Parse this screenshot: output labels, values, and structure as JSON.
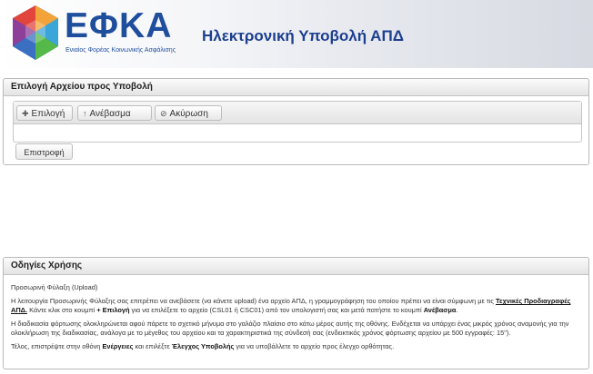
{
  "header": {
    "logo_text": "ΕΦΚΑ",
    "logo_subtitle": "Ενιαίος Φορέας Κοινωνικής Ασφάλισης",
    "app_title": "Ηλεκτρονική Υποβολή ΑΠΔ",
    "logo_colors": [
      "#f2a43a",
      "#e2453c",
      "#8e3f9a",
      "#3a6fc1",
      "#3aa5d8",
      "#54b948"
    ]
  },
  "upload_panel": {
    "title": "Επιλογή Αρχείου προς Υποβολή",
    "choose_label": "Επιλογή",
    "choose_icon": "plus-icon",
    "upload_label": "Ανέβασμα",
    "upload_icon": "upload-arrow-icon",
    "cancel_label": "Ακύρωση",
    "cancel_icon": "cancel-circle-icon",
    "back_label": "Επιστροφή"
  },
  "help_panel": {
    "title": "Οδηγίες Χρήσης",
    "p1": "Προσωρινή Φύλαξη (Upload)",
    "p2": {
      "t1": "Η λειτουργία Προσωρινής Φύλαξης σας επιτρέπει να ανεβάσετε (να κάνετε upload) ένα αρχείο ΑΠΔ, η γραμμογράφηση του οποίου πρέπει να είναι σύμφωνη με τις ",
      "link": "Τεχνικές Προδιαγραφές ΑΠΔ.",
      "t2": " Κάντε κλικ στο κουμπί ",
      "b1": "+ Επιλογή",
      "t3": " για να επιλέξετε το αρχείο (CSL01 ή CSC01) από τον υπολογιστή σας και μετά πατήστε το κουμπί ",
      "b2": "Ανέβασμα",
      "t4": "."
    },
    "p3": "Η διαδικασία φόρτωσης ολοκληρώνεται αφού πάρετε το σχετικό μήνυμα στο γαλάζιο πλαίσιο στο κάτω μέρος αυτής της οθόνης. Ενδέχεται να υπάρχει ένας μικρός χρόνος αναμονής για την ολοκλήρωση της διαδικασίας, ανάλογα με το μέγεθος του αρχείου και τα χαρακτηριστικά της σύνδεσή σας (ενδεικτικός χρόνος φόρτωσης αρχείου με 500 εγγραφές: 15\").",
    "p4": {
      "t1": "Τέλος, επιστρέψτε στην οθόνη ",
      "b1": "Ενέργειες",
      "t2": " και επιλέξτε ",
      "b2": "Έλεγχος Υποβολής",
      "t3": " για να υποβάλλετε το αρχείο προς έλεγχο ορθότητας."
    }
  }
}
